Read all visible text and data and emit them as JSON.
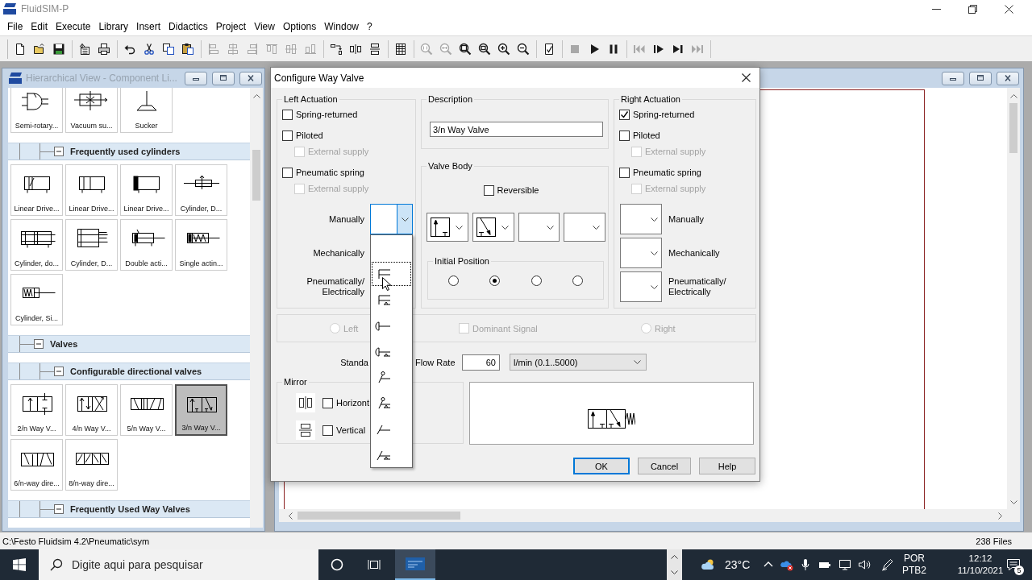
{
  "app": {
    "title": "FluidSIM-P"
  },
  "menu": [
    "File",
    "Edit",
    "Execute",
    "Library",
    "Insert",
    "Didactics",
    "Project",
    "View",
    "Options",
    "Window",
    "?"
  ],
  "toolbar": [
    [
      {
        "kind": "new",
        "disabled": false
      },
      {
        "kind": "open",
        "disabled": false
      },
      {
        "kind": "save",
        "disabled": false
      }
    ],
    [
      {
        "kind": "export",
        "disabled": false
      },
      {
        "kind": "print",
        "disabled": false
      }
    ],
    [
      {
        "kind": "undo",
        "disabled": false
      },
      {
        "kind": "cut",
        "disabled": false
      },
      {
        "kind": "copy",
        "disabled": false
      },
      {
        "kind": "paste",
        "disabled": false
      }
    ],
    [
      {
        "kind": "alignleft",
        "disabled": true
      },
      {
        "kind": "aligncenter",
        "disabled": true
      },
      {
        "kind": "alignright",
        "disabled": true
      },
      {
        "kind": "aligntop",
        "disabled": true
      },
      {
        "kind": "alignmiddle",
        "disabled": true
      },
      {
        "kind": "alignbottom",
        "disabled": true
      }
    ],
    [
      {
        "kind": "rotate",
        "disabled": false
      },
      {
        "kind": "mirrorh",
        "disabled": false
      },
      {
        "kind": "mirrorv",
        "disabled": false
      }
    ],
    [
      {
        "kind": "grid",
        "disabled": false
      }
    ],
    [
      {
        "kind": "zoomreal",
        "disabled": true
      },
      {
        "kind": "zoomfit",
        "disabled": true
      },
      {
        "kind": "zoomwindow",
        "disabled": false
      },
      {
        "kind": "zoompage",
        "disabled": false
      },
      {
        "kind": "zoomin",
        "disabled": false
      },
      {
        "kind": "zoomout",
        "disabled": false
      }
    ],
    [
      {
        "kind": "check",
        "disabled": false
      }
    ],
    [
      {
        "kind": "stop",
        "disabled": true
      },
      {
        "kind": "play",
        "disabled": false
      },
      {
        "kind": "pause",
        "disabled": false
      }
    ],
    [
      {
        "kind": "first",
        "disabled": true
      },
      {
        "kind": "step",
        "disabled": false
      },
      {
        "kind": "last",
        "disabled": false
      },
      {
        "kind": "fastforward",
        "disabled": true
      }
    ]
  ],
  "library_window": {
    "title": "Hierarchical View - Component Li...",
    "tree": [
      {
        "children": [
          {
            "tiles": [
              {
                "kind": "semirotary",
                "label": "Semi-rotary...",
                "selected": false
              },
              {
                "kind": "vacuum",
                "label": "Vacuum su...",
                "selected": false
              },
              {
                "kind": "sucker",
                "label": "Sucker",
                "selected": false
              }
            ]
          },
          {
            "label": "Frequently used cylinders",
            "expanded": true,
            "tiles": [
              {
                "kind": "linear1",
                "label": "Linear Drive...",
                "selected": false
              },
              {
                "kind": "linear2",
                "label": "Linear Drive...",
                "selected": false
              },
              {
                "kind": "linear3",
                "label": "Linear Drive...",
                "selected": false
              },
              {
                "kind": "rodcylinder",
                "label": "Cylinder, D...",
                "selected": false
              },
              {
                "kind": "tandem",
                "label": "Cylinder, do...",
                "selected": false
              },
              {
                "kind": "guided",
                "label": "Cylinder, D...",
                "selected": false
              },
              {
                "kind": "doubleacting",
                "label": "Double acti...",
                "selected": false
              },
              {
                "kind": "singleacting",
                "label": "Single actin...",
                "selected": false
              },
              {
                "kind": "springcylinder",
                "label": "Cylinder, Si...",
                "selected": false
              }
            ]
          }
        ]
      },
      {
        "label": "Valves",
        "expanded": true,
        "children": [
          {
            "label": "Configurable directional valves",
            "expanded": true,
            "tiles": [
              {
                "kind": "valve2",
                "label": "2/n Way V...",
                "selected": false
              },
              {
                "kind": "valve4",
                "label": "4/n Way V...",
                "selected": false
              },
              {
                "kind": "valve5",
                "label": "5/n Way V...",
                "selected": false
              },
              {
                "kind": "valve3",
                "label": "3/n Way V...",
                "selected": true
              },
              {
                "kind": "valve6",
                "label": "6/n-way dire...",
                "selected": false
              },
              {
                "kind": "valve8",
                "label": "8/n-way dire...",
                "selected": false
              }
            ]
          },
          {
            "label": "Frequently Used Way Valves",
            "expanded": true
          }
        ]
      }
    ]
  },
  "dialog": {
    "title": "Configure Way Valve",
    "left_actuation": {
      "title": "Left Actuation",
      "options": [
        {
          "label": "Spring-returned",
          "checked": false,
          "disabled": false
        },
        {
          "label": "Piloted",
          "checked": false,
          "disabled": false,
          "children": [
            {
              "label": "External supply",
              "checked": false,
              "disabled": true
            }
          ]
        },
        {
          "label": "Pneumatic spring",
          "checked": false,
          "disabled": false,
          "children": [
            {
              "label": "External supply",
              "checked": false,
              "disabled": true
            }
          ]
        }
      ],
      "operators": [
        {
          "label": "Manually",
          "combo": {
            "open": true,
            "options": [
              {
                "kind": "none",
                "selected": false
              },
              {
                "kind": "general",
                "detent": false,
                "selected": true
              },
              {
                "kind": "general",
                "detent": true,
                "selected": false
              },
              {
                "kind": "pushbutton",
                "detent": false,
                "selected": false
              },
              {
                "kind": "pushbutton",
                "detent": true,
                "selected": false
              },
              {
                "kind": "lever",
                "detent": false,
                "selected": false
              },
              {
                "kind": "lever",
                "detent": true,
                "selected": false
              },
              {
                "kind": "pedal",
                "detent": false,
                "selected": false
              },
              {
                "kind": "pedal",
                "detent": true,
                "selected": false
              }
            ]
          }
        },
        {
          "label": "Mechanically"
        },
        {
          "label": "Pneumatically/ Electrically"
        }
      ]
    },
    "description": {
      "title": "Description",
      "value": "3/n Way Valve"
    },
    "valve_body": {
      "title": "Valve Body",
      "reversible": {
        "label": "Reversible",
        "checked": false
      },
      "positions": [
        {
          "kind": "straight"
        },
        {
          "kind": "diagonal"
        },
        {
          "kind": "empty"
        },
        {
          "kind": "empty"
        }
      ],
      "initial_position": {
        "title": "Initial Position",
        "options": [
          {
            "selected": false
          },
          {
            "selected": true
          },
          {
            "selected": false
          },
          {
            "selected": false
          }
        ]
      }
    },
    "right_actuation": {
      "title": "Right Actuation",
      "options": [
        {
          "label": "Spring-returned",
          "checked": true,
          "disabled": false
        },
        {
          "label": "Piloted",
          "checked": false,
          "disabled": false,
          "children": [
            {
              "label": "External supply",
              "checked": false,
              "disabled": true
            }
          ]
        },
        {
          "label": "Pneumatic spring",
          "checked": false,
          "disabled": false,
          "children": [
            {
              "label": "External supply",
              "checked": false,
              "disabled": true
            }
          ]
        }
      ],
      "operators": [
        {
          "label": "Manually",
          "combo": {
            "open": false
          }
        },
        {
          "label": "Mechanically",
          "combo": {
            "open": false
          }
        },
        {
          "label": "Pneumatically/ Electrically",
          "combo": {
            "open": false
          }
        }
      ]
    },
    "dominant": {
      "left": {
        "label": "Left",
        "selected": false,
        "disabled": true
      },
      "signal": {
        "label": "Dominant Signal",
        "checked": false,
        "disabled": true
      },
      "right": {
        "label": "Right",
        "selected": false,
        "disabled": true
      }
    },
    "flow_rate": {
      "label_start": "Standa",
      "label_end": "Flow Rate",
      "value": "60",
      "unit": "l/min (0.1..5000)"
    },
    "mirror": {
      "title": "Mirror",
      "options": [
        {
          "kind": "horizontal",
          "label": "Horizont",
          "checked": false
        },
        {
          "kind": "vertical",
          "label": "Vertical",
          "checked": false
        }
      ]
    },
    "buttons": [
      {
        "label": "OK",
        "default": true
      },
      {
        "label": "Cancel",
        "default": false
      },
      {
        "label": "Help",
        "default": false
      }
    ]
  },
  "status_bar": {
    "path": "C:\\Festo Fluidsim 4.2\\Pneumatic\\sym",
    "files": "238 Files"
  },
  "taskbar": {
    "search_placeholder": "Digite aqui para pesquisar",
    "app_button": {
      "active": true
    },
    "weather": "23°C",
    "language": "POR",
    "keyboard": "PTB2",
    "time": "12:12",
    "date": "11/10/2021",
    "notifications": "5"
  }
}
